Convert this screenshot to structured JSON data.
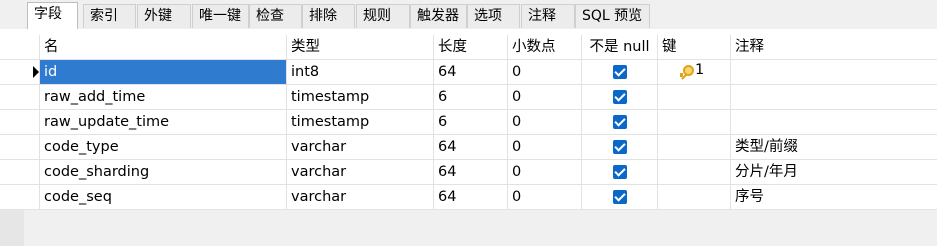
{
  "tabs": [
    {
      "label": "字段",
      "active": true
    },
    {
      "label": "索引"
    },
    {
      "label": "外键"
    },
    {
      "label": "唯一键"
    },
    {
      "label": "检查"
    },
    {
      "label": "排除"
    },
    {
      "label": "规则"
    },
    {
      "label": "触发器"
    },
    {
      "label": "选项"
    },
    {
      "label": "注释"
    },
    {
      "label": "SQL 预览"
    }
  ],
  "columns": {
    "name": "名",
    "type": "类型",
    "length": "长度",
    "decimals": "小数点",
    "not_null": "不是 null",
    "key": "键",
    "comment": "注释"
  },
  "fields": [
    {
      "name": "id",
      "type": "int8",
      "length": "64",
      "decimals": "0",
      "not_null": true,
      "key": "1",
      "comment": ""
    },
    {
      "name": "raw_add_time",
      "type": "timestamp",
      "length": "6",
      "decimals": "0",
      "not_null": true,
      "key": "",
      "comment": ""
    },
    {
      "name": "raw_update_time",
      "type": "timestamp",
      "length": "6",
      "decimals": "0",
      "not_null": true,
      "key": "",
      "comment": ""
    },
    {
      "name": "code_type",
      "type": "varchar",
      "length": "64",
      "decimals": "0",
      "not_null": true,
      "key": "",
      "comment": "类型/前缀"
    },
    {
      "name": "code_sharding",
      "type": "varchar",
      "length": "64",
      "decimals": "0",
      "not_null": true,
      "key": "",
      "comment": "分片/年月"
    },
    {
      "name": "code_seq",
      "type": "varchar",
      "length": "64",
      "decimals": "0",
      "not_null": true,
      "key": "",
      "comment": "序号"
    }
  ],
  "icons": {
    "primary_key": "key-icon",
    "checkbox": "checkbox-checked-icon",
    "row_pointer": "row-pointer-icon"
  },
  "colors": {
    "selection": "#2e7bd0",
    "checkbox": "#0a68c9"
  }
}
